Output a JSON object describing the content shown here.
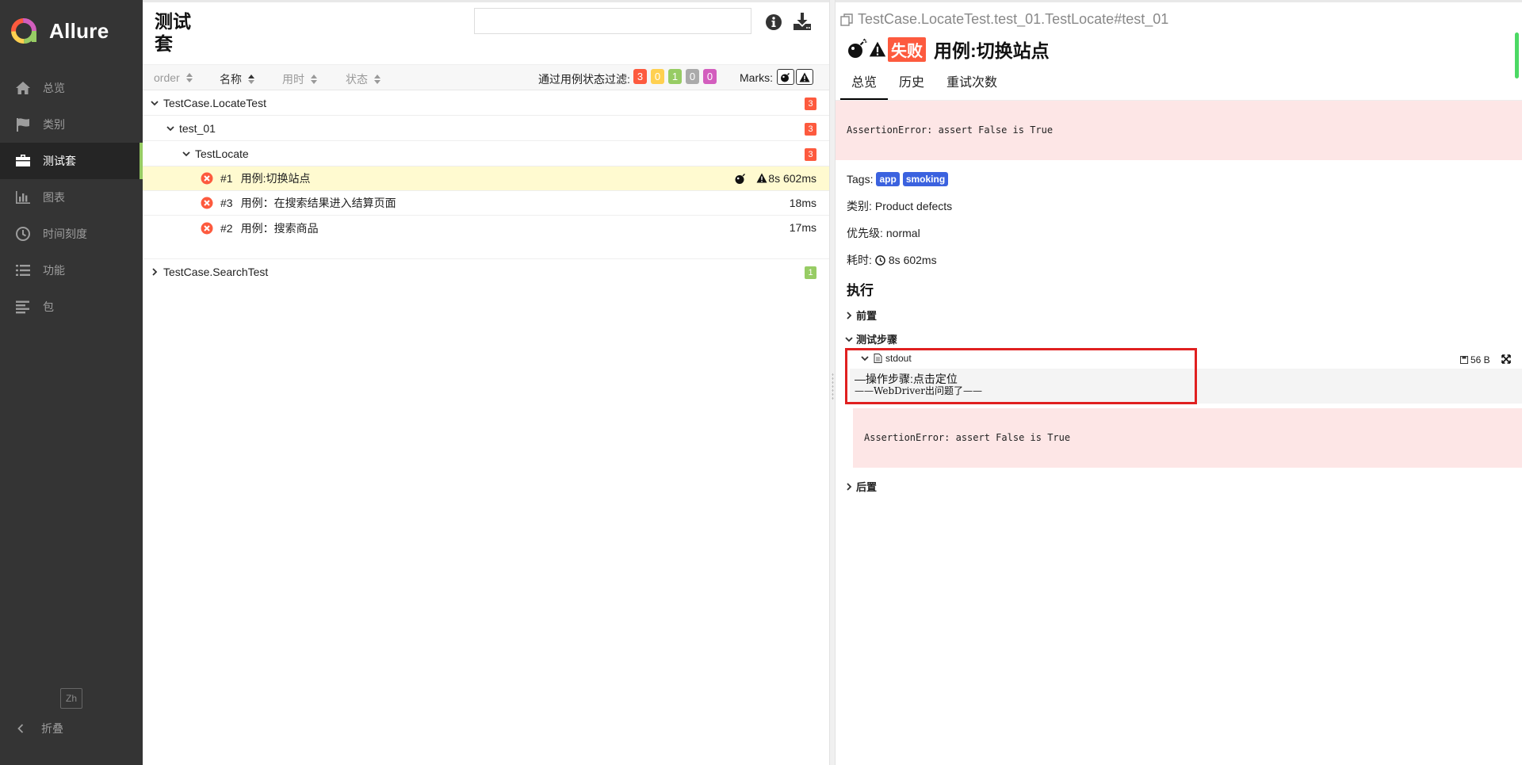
{
  "sidebar": {
    "brand": "Allure",
    "items": [
      {
        "label": "总览",
        "icon": "home-icon"
      },
      {
        "label": "类别",
        "icon": "flag-icon"
      },
      {
        "label": "测试套",
        "icon": "briefcase-icon"
      },
      {
        "label": "图表",
        "icon": "bar-chart-icon"
      },
      {
        "label": "时间刻度",
        "icon": "clock-icon"
      },
      {
        "label": "功能",
        "icon": "list-icon"
      },
      {
        "label": "包",
        "icon": "align-left-icon"
      }
    ],
    "active_item": "测试套",
    "language": "Zh",
    "collapse_label": "折叠"
  },
  "suites": {
    "title": "测试套",
    "search": {
      "value": "",
      "placeholder": ""
    },
    "sort": {
      "order": "order",
      "name": "名称",
      "duration": "用时",
      "status": "状态"
    },
    "filter_label": "通过用例状态过滤:",
    "filter_counts": [
      {
        "value": "3",
        "color": "#fd5a3e"
      },
      {
        "value": "0",
        "color": "#ffd050"
      },
      {
        "value": "1",
        "color": "#97cc64"
      },
      {
        "value": "0",
        "color": "#aaaaaa"
      },
      {
        "value": "0",
        "color": "#d35ebe"
      }
    ],
    "marks_label": "Marks:",
    "tree": {
      "group1": {
        "name": "TestCase.LocateTest",
        "count": "3"
      },
      "group2": {
        "name": "test_01",
        "count": "3"
      },
      "group3": {
        "name": "TestLocate",
        "count": "3"
      },
      "tests": [
        {
          "order": "#1",
          "name": "用例:切换站点",
          "duration": "8s 602ms"
        },
        {
          "order": "#3",
          "name": "用例：在搜索结果进入结算页面",
          "duration": "18ms"
        },
        {
          "order": "#2",
          "name": "用例：搜索商品",
          "duration": "17ms"
        }
      ],
      "group4": {
        "name": "TestCase.SearchTest",
        "count": "1"
      }
    }
  },
  "detail": {
    "path": "TestCase.LocateTest.test_01.TestLocate#test_01",
    "status": "失败",
    "title": "用例:切换站点",
    "tabs": [
      "总览",
      "历史",
      "重试次数"
    ],
    "error": "AssertionError: assert False is True",
    "tags_label": "Tags:",
    "tags": [
      "app",
      "smoking"
    ],
    "category_label": "类别:",
    "category": "Product defects",
    "severity_label": "优先级:",
    "severity": "normal",
    "duration_label": "耗时:",
    "duration": "8s 602ms",
    "execution_title": "执行",
    "setup_label": "前置",
    "steps_label": "测试步骤",
    "attachment": {
      "name": "stdout",
      "size": "56 B"
    },
    "stdout_lines": [
      "—操作步骤:点击定位",
      "——WebDriver出问题了——"
    ],
    "step_error": "AssertionError: assert False is True",
    "teardown_label": "后置"
  }
}
